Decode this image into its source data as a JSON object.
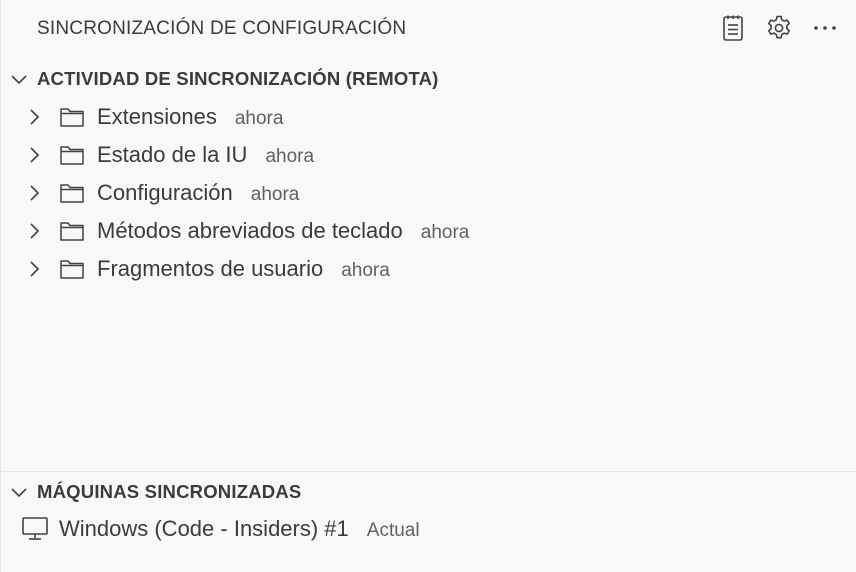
{
  "header": {
    "title": "SINCRONIZACIÓN DE CONFIGURACIÓN",
    "actions": [
      {
        "name": "notes-icon"
      },
      {
        "name": "gear-icon"
      },
      {
        "name": "more-icon"
      }
    ]
  },
  "activity": {
    "title": "ACTIVIDAD DE SINCRONIZACIÓN (REMOTA)",
    "expanded": true,
    "items": [
      {
        "label": "Extensiones",
        "time": "ahora"
      },
      {
        "label": "Estado de la IU",
        "time": "ahora"
      },
      {
        "label": "Configuración",
        "time": "ahora"
      },
      {
        "label": "Métodos abreviados de teclado",
        "time": "ahora"
      },
      {
        "label": "Fragmentos de usuario",
        "time": "ahora"
      }
    ]
  },
  "machines": {
    "title": "MÁQUINAS SINCRONIZADAS",
    "expanded": true,
    "items": [
      {
        "label": "Windows (Code - Insiders) #1",
        "status": "Actual"
      }
    ]
  },
  "colors": {
    "background": "#f8f8f8",
    "foreground": "#3b3b3b",
    "description": "#616161",
    "border": "#e5e5e5"
  }
}
